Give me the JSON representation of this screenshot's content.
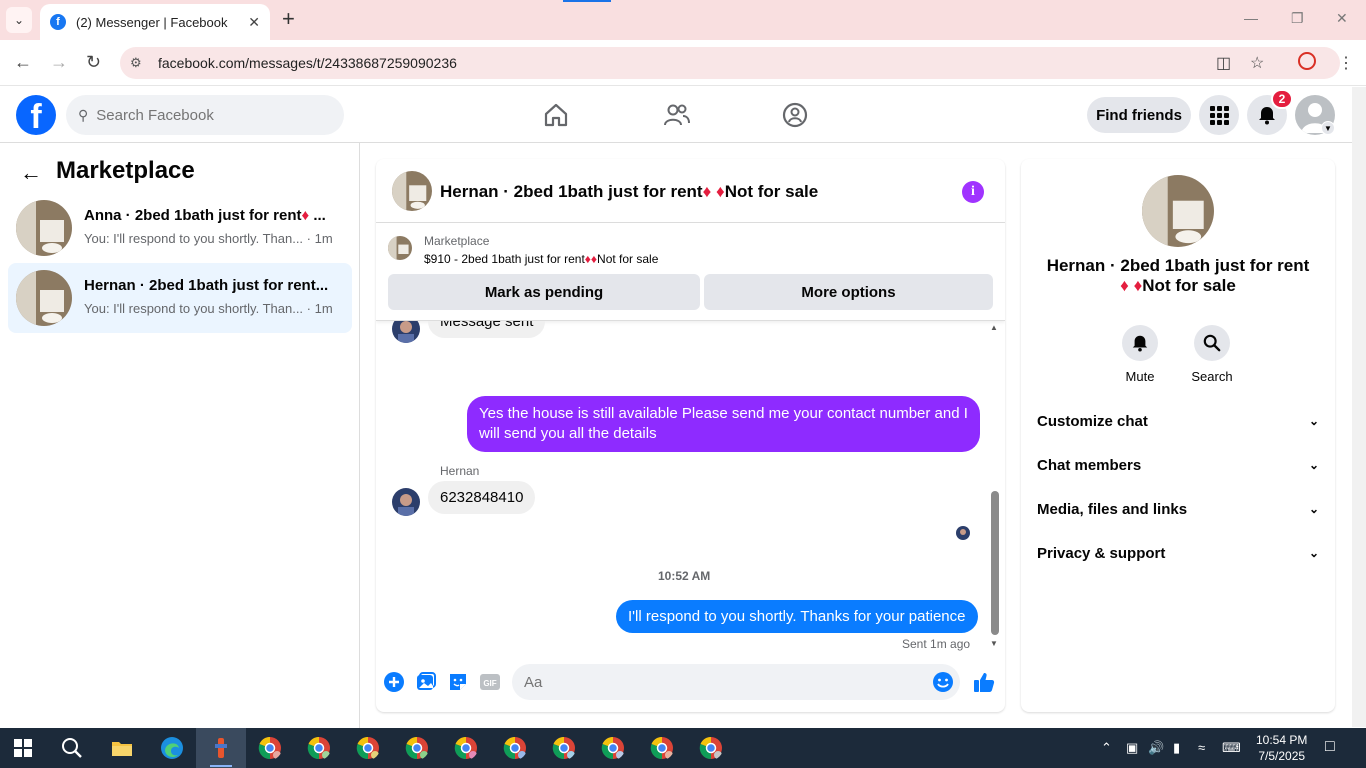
{
  "browser": {
    "tab_title": "(2) Messenger | Facebook",
    "favicon": "f",
    "url": "facebook.com/messages/t/24338687259090236"
  },
  "header": {
    "search_placeholder": "Search Facebook",
    "find_friends": "Find friends",
    "notification_count": "2"
  },
  "sidebar": {
    "title": "Marketplace",
    "conversations": [
      {
        "title": "Anna · 2bed 1bath just for rent♦ ...",
        "preview": "You: I'll respond to you shortly. Than...",
        "time": "· 1m"
      },
      {
        "title": "Hernan · 2bed 1bath just for rent...",
        "preview": "You: I'll respond to you shortly. Than...",
        "time": "· 1m"
      }
    ]
  },
  "chat": {
    "title": "Hernan · 2bed 1bath just for rent♦ ♦Not for sale",
    "listing_kind": "Marketplace",
    "listing_desc": "$910 - 2bed 1bath just for rent♦♦Not for sale",
    "mark_pending": "Mark as pending",
    "more_options": "More options",
    "clipped_message": "Message sent",
    "outgoing_1": "Yes the house is still available Please send me your contact number and I will send you all the details",
    "sender_name": "Hernan",
    "incoming_1": "6232848410",
    "timestamp": "10:52 AM",
    "outgoing_2": "I'll respond to you shortly. Thanks for your patience",
    "sent_status": "Sent 1m ago",
    "composer_placeholder": "Aa"
  },
  "info_panel": {
    "name_line1": "Hernan · 2bed 1bath just for rent",
    "name_line2": "♦ ♦Not for sale",
    "mute": "Mute",
    "search": "Search",
    "sections": [
      "Customize chat",
      "Chat members",
      "Media, files and links",
      "Privacy & support"
    ]
  },
  "taskbar": {
    "time": "10:54 PM",
    "date": "7/5/2025"
  },
  "colors": {
    "fb_blue": "#0866ff",
    "messenger_purple": "#8e2bff",
    "messenger_blue": "#0a7cff",
    "diamond_red": "#e41e3f"
  }
}
